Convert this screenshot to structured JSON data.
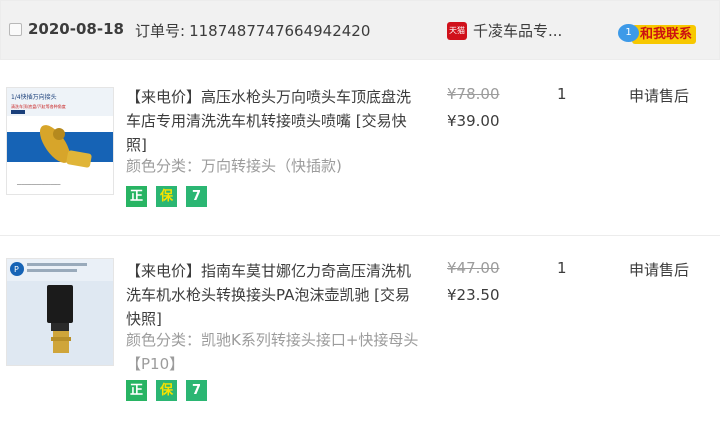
{
  "header": {
    "date": "2020-08-18",
    "order_no_label": "订单号:",
    "order_no": "1187487747664942420",
    "shop_badge": "天猫",
    "shop_name": "千凌车品专...",
    "contact_bubble": "1",
    "contact_label": "和我联系"
  },
  "items": [
    {
      "title": "【来电价】高压水枪头万向喷头车顶底盘洗车店专用清洗洗车机转接喷头喷嘴 [交易快照]",
      "attr": "颜色分类：万向转接头（快插款)",
      "orig_price": "¥78.00",
      "price": "¥39.00",
      "qty": "1",
      "aftersale": "申请售后",
      "thumb_caption": "1/4快插万向接头",
      "thumb_sub": "清洗车顶/底盘/汽缸等各种角度",
      "badges": [
        "正",
        "保",
        "7"
      ]
    },
    {
      "title": "【来电价】指南车莫甘娜亿力奇高压清洗机洗车机水枪头转换接头PA泡沫壶凯驰 [交易快照]",
      "attr": "颜色分类：凯驰K系列转接头接口+快接母头【P10】",
      "orig_price": "¥47.00",
      "price": "¥23.50",
      "qty": "1",
      "aftersale": "申请售后",
      "thumb_caption": "P",
      "badges": [
        "正",
        "保",
        "7"
      ]
    }
  ],
  "colors": {
    "header_bg": "#f1f1f1",
    "tmall_red": "#d0111b",
    "badge_green": "#2bb673",
    "contact_yellow": "#f7c800",
    "contact_blue": "#3d9ae8"
  }
}
